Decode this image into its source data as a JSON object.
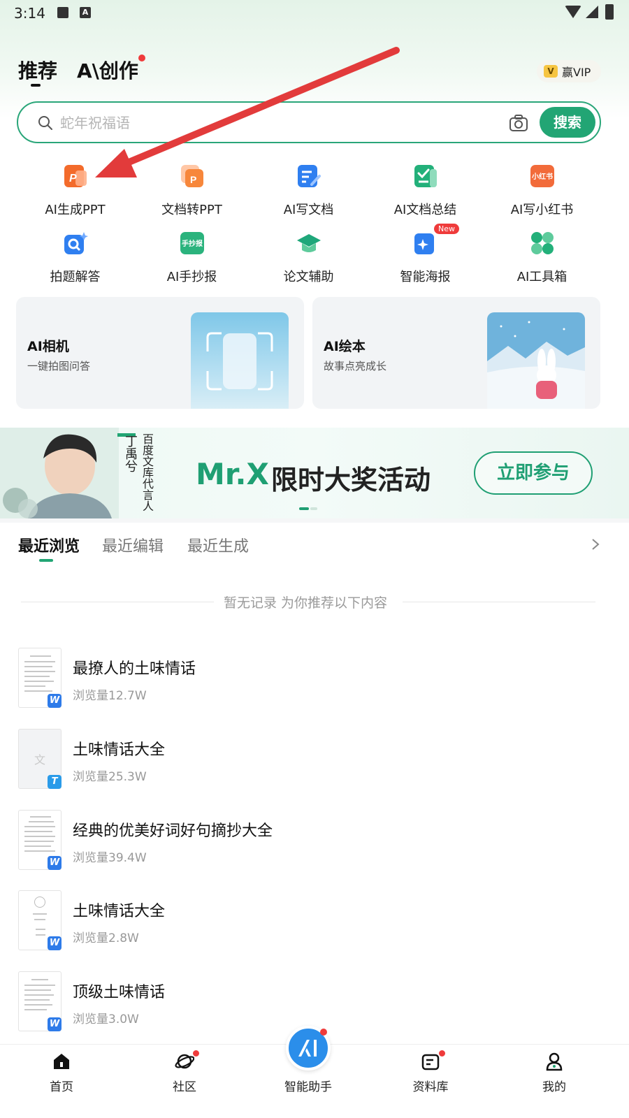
{
  "status_bar": {
    "time": "3:14"
  },
  "header": {
    "tab_recommend": "推荐",
    "tab_create": "创作",
    "tab_create_prefix": "A\\",
    "vip_badge": "V",
    "vip_label": "赢VIP"
  },
  "search": {
    "placeholder": "蛇年祝福语",
    "button_label": "搜索"
  },
  "tools": [
    {
      "label": "AI生成PPT",
      "icon": "ai-ppt-icon",
      "color": "#f36b2b"
    },
    {
      "label": "文档转PPT",
      "icon": "doc-to-ppt-icon",
      "color": "#f7873b"
    },
    {
      "label": "AI写文档",
      "icon": "ai-write-doc-icon",
      "color": "#2f7ff0"
    },
    {
      "label": "AI文档总结",
      "icon": "ai-doc-summary-icon",
      "color": "#23b07a"
    },
    {
      "label": "AI写小红书",
      "icon": "ai-xiaohongshu-icon",
      "color": "#f26b3a",
      "icon_text": "小红书"
    },
    {
      "label": "拍题解答",
      "icon": "photo-answer-icon",
      "color": "#2f7ff0"
    },
    {
      "label": "AI手抄报",
      "icon": "ai-handcopy-icon",
      "color": "#2bb37d",
      "icon_text": "手抄报"
    },
    {
      "label": "论文辅助",
      "icon": "thesis-assist-icon",
      "color": "#1fa77a"
    },
    {
      "label": "智能海报",
      "icon": "smart-poster-icon",
      "color": "#2f7ff0",
      "badge": "New"
    },
    {
      "label": "AI工具箱",
      "icon": "ai-toolbox-icon",
      "color": "#23b07a"
    }
  ],
  "cards": [
    {
      "title": "AI相机",
      "subtitle": "一键拍图问答"
    },
    {
      "title": "AI绘本",
      "subtitle": "故事点亮成长"
    }
  ],
  "banner": {
    "spokesperson": "丁禹兮",
    "role": "百度文库代言人",
    "brand": "Mr.X",
    "title": "限时大奖活动",
    "cta": "立即参与"
  },
  "recent": {
    "tabs": [
      "最近浏览",
      "最近编辑",
      "最近生成"
    ],
    "empty_text": "暂无记录 为你推荐以下内容"
  },
  "documents": [
    {
      "title": "最撩人的土味情话",
      "views": "浏览量12.7W",
      "badge": "W"
    },
    {
      "title": "土味情话大全",
      "views": "浏览量25.3W",
      "badge": "T",
      "thumb_text": "文"
    },
    {
      "title": "经典的优美好词好句摘抄大全",
      "views": "浏览量39.4W",
      "badge": "W"
    },
    {
      "title": "土味情话大全",
      "views": "浏览量2.8W",
      "badge": "W"
    },
    {
      "title": "顶级土味情话",
      "views": "浏览量3.0W",
      "badge": "W"
    }
  ],
  "bottom_nav": [
    {
      "label": "首页",
      "icon": "home-icon"
    },
    {
      "label": "社区",
      "icon": "planet-icon"
    },
    {
      "label": "智能助手",
      "icon": "assistant-icon"
    },
    {
      "label": "资料库",
      "icon": "library-icon"
    },
    {
      "label": "我的",
      "icon": "profile-icon"
    }
  ],
  "colors": {
    "accent": "#22a574",
    "vip_gold": "#f6c542",
    "alert_red": "#ef3b3b",
    "arrow_red": "#e23b3b"
  }
}
